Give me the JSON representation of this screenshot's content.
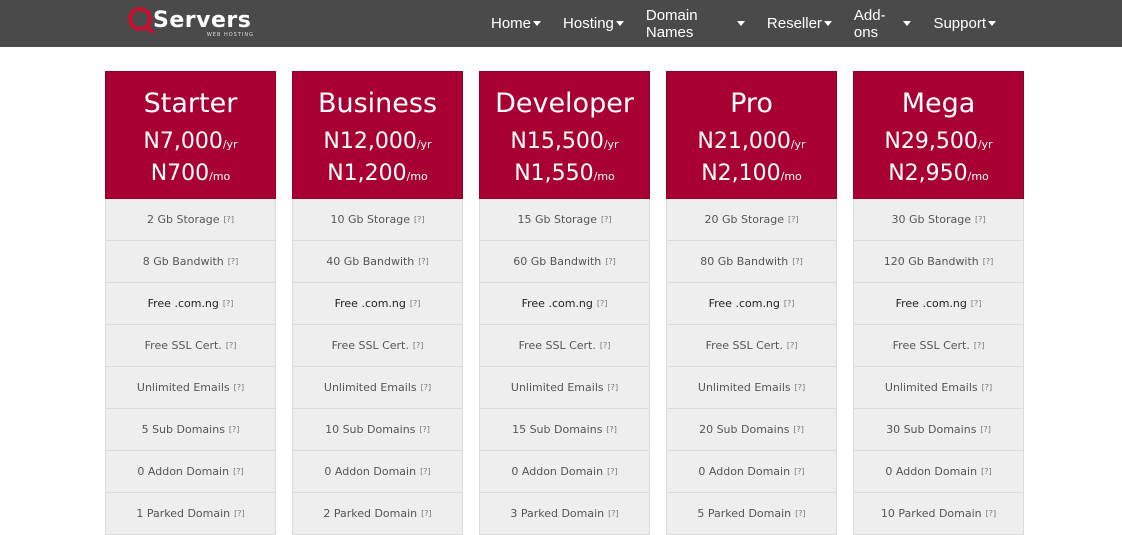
{
  "brand": {
    "logo_text": "Servers",
    "logo_sub": "WEB HOSTING",
    "colors": {
      "header_bg": "#4a4a4a",
      "accent": "#a80032",
      "feature_bg": "#eeeeee"
    }
  },
  "nav": {
    "items": [
      {
        "label": "Home"
      },
      {
        "label": "Hosting"
      },
      {
        "label": "Domain Names"
      },
      {
        "label": "Reseller"
      },
      {
        "label": "Add-ons"
      },
      {
        "label": "Support"
      }
    ]
  },
  "help_marker": "[?]",
  "plans": [
    {
      "name": "Starter",
      "price_year": "N7,000",
      "year_unit": "/yr",
      "price_month": "N700",
      "month_unit": "/mo",
      "features": {
        "storage": "2 Gb Storage",
        "bandwidth": "8 Gb Bandwith",
        "domain": "Free .com.ng",
        "ssl": "Free SSL Cert.",
        "emails": "Unlimited Emails",
        "subdomains": "5 Sub Domains",
        "addon": "0 Addon Domain",
        "parked": "1 Parked Domain"
      }
    },
    {
      "name": "Business",
      "price_year": "N12,000",
      "year_unit": "/yr",
      "price_month": "N1,200",
      "month_unit": "/mo",
      "features": {
        "storage": "10 Gb Storage",
        "bandwidth": "40 Gb Bandwith",
        "domain": "Free .com.ng",
        "ssl": "Free SSL Cert.",
        "emails": "Unlimited Emails",
        "subdomains": "10 Sub Domains",
        "addon": "0 Addon Domain",
        "parked": "2 Parked Domain"
      }
    },
    {
      "name": "Developer",
      "price_year": "N15,500",
      "year_unit": "/yr",
      "price_month": "N1,550",
      "month_unit": "/mo",
      "features": {
        "storage": "15 Gb Storage",
        "bandwidth": "60 Gb Bandwith",
        "domain": "Free .com.ng",
        "ssl": "Free SSL Cert.",
        "emails": "Unlimited Emails",
        "subdomains": "15 Sub Domains",
        "addon": "0 Addon Domain",
        "parked": "3 Parked Domain"
      }
    },
    {
      "name": "Pro",
      "price_year": "N21,000",
      "year_unit": "/yr",
      "price_month": "N2,100",
      "month_unit": "/mo",
      "features": {
        "storage": "20 Gb Storage",
        "bandwidth": "80 Gb Bandwith",
        "domain": "Free .com.ng",
        "ssl": "Free SSL Cert.",
        "emails": "Unlimited Emails",
        "subdomains": "20 Sub Domains",
        "addon": "0 Addon Domain",
        "parked": "5 Parked Domain"
      }
    },
    {
      "name": "Mega",
      "price_year": "N29,500",
      "year_unit": "/yr",
      "price_month": "N2,950",
      "month_unit": "/mo",
      "features": {
        "storage": "30 Gb Storage",
        "bandwidth": "120 Gb Bandwith",
        "domain": "Free .com.ng",
        "ssl": "Free SSL Cert.",
        "emails": "Unlimited Emails",
        "subdomains": "30 Sub Domains",
        "addon": "0 Addon Domain",
        "parked": "10 Parked Domain"
      }
    }
  ]
}
